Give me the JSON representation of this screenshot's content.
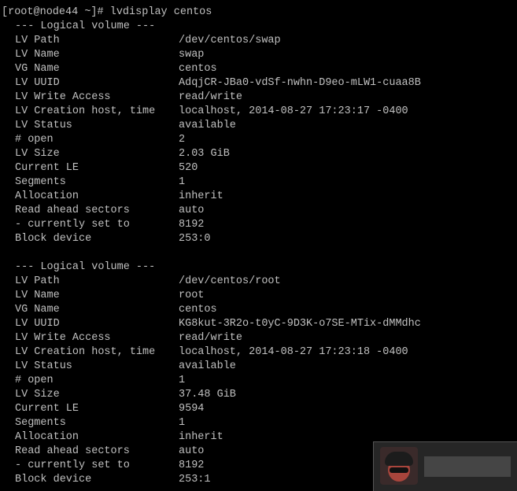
{
  "prompt": "[root@node44 ~]# ",
  "command": "lvdisplay centos",
  "volumes": [
    {
      "header": "--- Logical volume ---",
      "fields": [
        {
          "label": "LV Path",
          "value": "/dev/centos/swap"
        },
        {
          "label": "LV Name",
          "value": "swap"
        },
        {
          "label": "VG Name",
          "value": "centos"
        },
        {
          "label": "LV UUID",
          "value": "AdqjCR-JBa0-vdSf-nwhn-D9eo-mLW1-cuaa8B"
        },
        {
          "label": "LV Write Access",
          "value": "read/write"
        },
        {
          "label": "LV Creation host, time",
          "value": "localhost, 2014-08-27 17:23:17 -0400"
        },
        {
          "label": "LV Status",
          "value": "available"
        },
        {
          "label": "# open",
          "value": "2"
        },
        {
          "label": "LV Size",
          "value": "2.03 GiB"
        },
        {
          "label": "Current LE",
          "value": "520"
        },
        {
          "label": "Segments",
          "value": "1"
        },
        {
          "label": "Allocation",
          "value": "inherit"
        },
        {
          "label": "Read ahead sectors",
          "value": "auto"
        },
        {
          "label": "- currently set to",
          "value": "8192"
        },
        {
          "label": "Block device",
          "value": "253:0"
        }
      ]
    },
    {
      "header": "--- Logical volume ---",
      "fields": [
        {
          "label": "LV Path",
          "value": "/dev/centos/root"
        },
        {
          "label": "LV Name",
          "value": "root"
        },
        {
          "label": "VG Name",
          "value": "centos"
        },
        {
          "label": "LV UUID",
          "value": "KG8kut-3R2o-t0yC-9D3K-o7SE-MTix-dMMdhc"
        },
        {
          "label": "LV Write Access",
          "value": "read/write"
        },
        {
          "label": "LV Creation host, time",
          "value": "localhost, 2014-08-27 17:23:18 -0400"
        },
        {
          "label": "LV Status",
          "value": "available"
        },
        {
          "label": "# open",
          "value": "1"
        },
        {
          "label": "LV Size",
          "value": "37.48 GiB"
        },
        {
          "label": "Current LE",
          "value": "9594"
        },
        {
          "label": "Segments",
          "value": "1"
        },
        {
          "label": "Allocation",
          "value": "inherit"
        },
        {
          "label": "Read ahead sectors",
          "value": "auto"
        },
        {
          "label": "- currently set to",
          "value": "8192"
        },
        {
          "label": "Block device",
          "value": "253:1"
        }
      ]
    }
  ],
  "colors": {
    "background": "#000000",
    "foreground": "#c0c0c0"
  },
  "watermark_icon": "avatar-watermark-icon"
}
